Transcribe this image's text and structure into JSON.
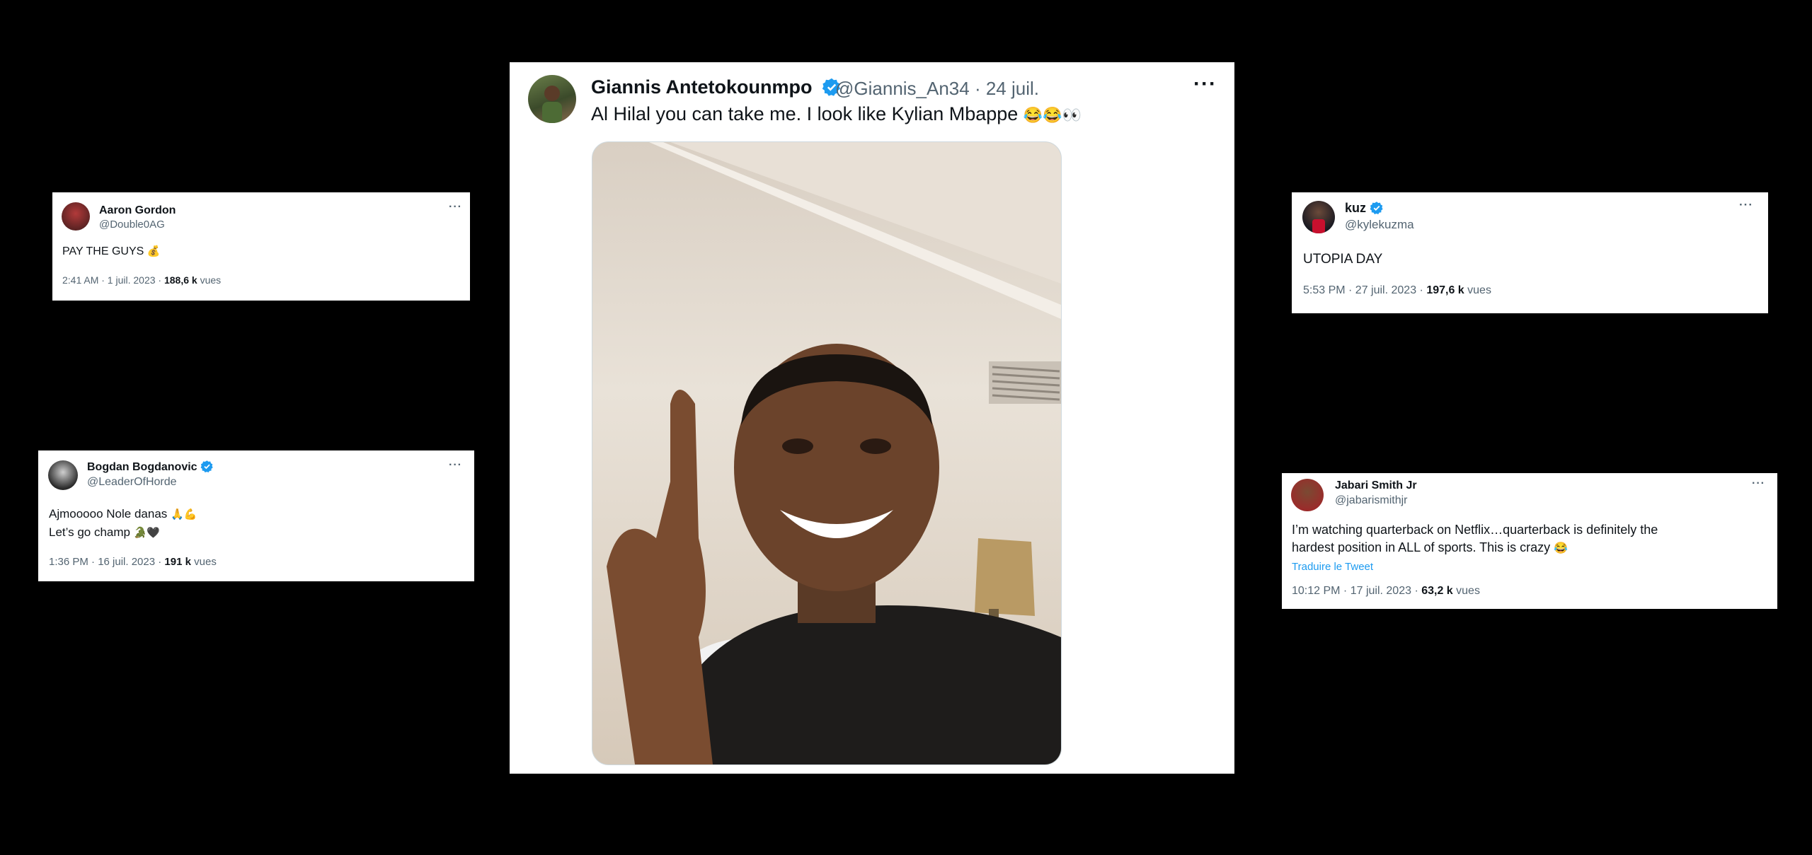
{
  "main_tweet": {
    "name": "Giannis Antetokounmpo",
    "handle_time": "@Giannis_An34 · 24 juil.",
    "text": "Al Hilal you can take me. I look like Kylian Mbappe",
    "emojis": [
      "😂",
      "😂",
      "👀"
    ]
  },
  "aaron_tweet": {
    "name": "Aaron Gordon",
    "handle": "@Double0AG",
    "text": "PAY THE GUYS",
    "emoji": "💰",
    "time": "2:41 AM · 1 juil. 2023 · ",
    "views_count": "188,6 k",
    "views_label": " vues"
  },
  "kuz_tweet": {
    "name": "kuz",
    "handle": "@kylekuzma",
    "text": "UTOPIA DAY",
    "time": "5:53 PM · 27 juil. 2023 · ",
    "views_count": "197,6 k",
    "views_label": " vues"
  },
  "bogdan_tweet": {
    "name": "Bogdan Bogdanovic",
    "handle": "@LeaderOfHorde",
    "line1": "Ajmooooo Nole danas",
    "line1_emoji": "🙏💪",
    "line2": "Let’s go champ",
    "line2_emoji": "🐊🖤",
    "time": "1:36 PM · 16 juil. 2023 · ",
    "views_count": "191 k",
    "views_label": " vues"
  },
  "jabari_tweet": {
    "name": "Jabari Smith Jr",
    "handle": "@jabarismithjr",
    "line1": "I’m watching quarterback on Netflix…quarterback is definitely the",
    "line2": "hardest position in ALL of sports. This is crazy",
    "line2_emoji": "😂",
    "translate": "Traduire le Tweet",
    "time": "10:12 PM · 17 juil. 2023 · ",
    "views_count": "63,2 k",
    "views_label": " vues"
  },
  "more_label": "···",
  "colors": {
    "verified": "#1d9bf0",
    "link": "#1d9bf0",
    "muted": "#536471"
  }
}
